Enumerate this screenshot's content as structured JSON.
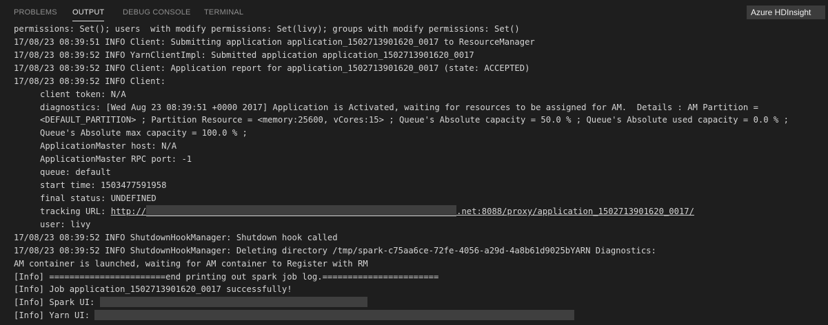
{
  "panel": {
    "tabs": [
      "PROBLEMS",
      "OUTPUT",
      "DEBUG CONSOLE",
      "TERMINAL"
    ],
    "active_tab": "OUTPUT",
    "output_channel": "Azure HDInsight"
  },
  "log": {
    "line_01": "permissions: Set(); users  with modify permissions: Set(livy); groups with modify permissions: Set()",
    "line_02": "17/08/23 08:39:51 INFO Client: Submitting application application_1502713901620_0017 to ResourceManager",
    "line_03": "17/08/23 08:39:52 INFO YarnClientImpl: Submitted application application_1502713901620_0017",
    "line_04": "17/08/23 08:39:52 INFO Client: Application report for application_1502713901620_0017 (state: ACCEPTED)",
    "line_05": "17/08/23 08:39:52 INFO Client:",
    "line_06": "client token: N/A",
    "line_07": "diagnostics: [Wed Aug 23 08:39:51 +0000 2017] Application is Activated, waiting for resources to be assigned for AM.  Details : AM Partition =",
    "line_08": "<DEFAULT_PARTITION> ; Partition Resource = <memory:25600, vCores:15> ; Queue's Absolute capacity = 50.0 % ; Queue's Absolute used capacity = 0.0 % ;",
    "line_09": "Queue's Absolute max capacity = 100.0 % ;",
    "line_10": "ApplicationMaster host: N/A",
    "line_11": "ApplicationMaster RPC port: -1",
    "line_12": "queue: default",
    "line_13": "start time: 1503477591958",
    "line_14": "final status: UNDEFINED",
    "tracking_label": "tracking URL: ",
    "tracking_url_prefix": "http://",
    "tracking_url_suffix": ".net:8088/proxy/application_1502713901620_0017/",
    "line_16": "user: livy",
    "line_17": "17/08/23 08:39:52 INFO ShutdownHookManager: Shutdown hook called",
    "line_18": "17/08/23 08:39:52 INFO ShutdownHookManager: Deleting directory /tmp/spark-c75aa6ce-72fe-4056-a29d-4a8b61d9025bYARN Diagnostics:",
    "line_19": "AM container is launched, waiting for AM container to Register with RM",
    "line_20": "[Info] =======================end printing out spark job log.=======================",
    "line_21": "[Info] Job application_1502713901620_0017 successfully!",
    "spark_ui_label": "[Info] Spark UI: ",
    "yarn_ui_label": "[Info] Yarn UI: "
  },
  "colors": {
    "background": "#1e1e1e",
    "text": "#d4d4d4",
    "tab_inactive": "#8f8f8f",
    "tab_active": "#e7e7e7",
    "dropdown_bg": "#3c3c3c",
    "redaction": "#3f3f3f"
  }
}
